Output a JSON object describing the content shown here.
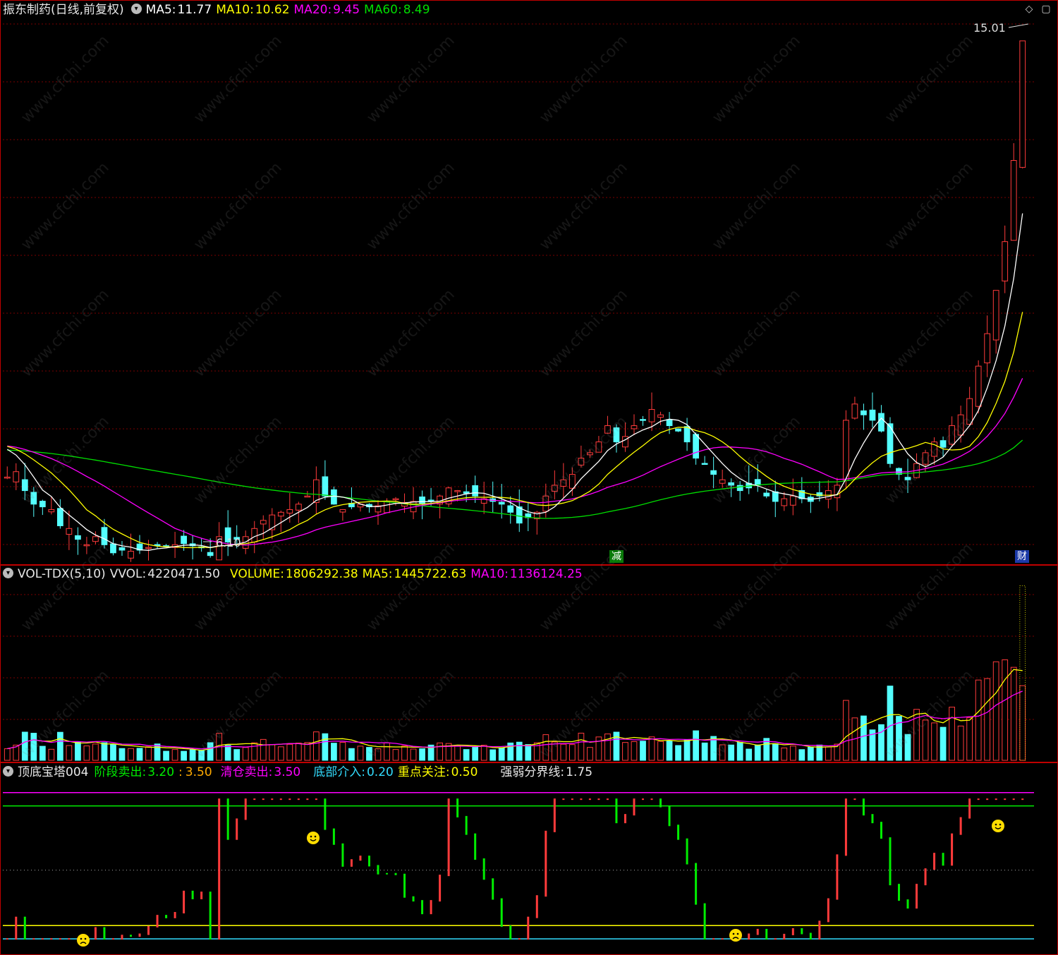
{
  "colors": {
    "up": "#ff3b3b",
    "down": "#54ffff",
    "ma5": "#ffffff",
    "ma10": "#ffff00",
    "ma20": "#ff00ff",
    "ma60": "#00dd00",
    "grid": "#7a0000",
    "divider": "#c00000"
  },
  "main": {
    "title": "振东制药(日线,前复权)",
    "ma5_label": "MA5:",
    "ma5": "11.77",
    "ma10_label": "MA10:",
    "ma10": "10.62",
    "ma20_label": "MA20:",
    "ma20": "9.45",
    "ma60_label": "MA60:",
    "ma60": "8.49",
    "high_label": "15.01",
    "low_label": "6.10",
    "event_reduce": "减",
    "event_finance": "财"
  },
  "volume": {
    "title": "VOL-TDX(5,10)",
    "vvol_label": "VVOL:",
    "vvol": "4220471.50",
    "volume_label": "VOLUME:",
    "volume": "1806292.38",
    "ma5_label": "MA5:",
    "ma5": "1445722.63",
    "ma10_label": "MA10:",
    "ma10": "1136124.25"
  },
  "indicator": {
    "title": "顶底宝塔004",
    "stage_sell_label": "阶段卖出:",
    "stage_sell": "3.20",
    "stage_sell2_sep": ":",
    "stage_sell2": "3.50",
    "clear_sell_label": "清仓卖出:",
    "clear_sell": "3.50",
    "bottom_entry_label": "底部介入:",
    "bottom_entry": "0.20",
    "focus_label": "重点关注:",
    "focus": "0.50",
    "divide_label": "强弱分界线:",
    "divide": "1.75"
  },
  "watermark": "www.cfchi.com",
  "chart_data": {
    "type": "candlestick",
    "price_ylim": [
      5.6,
      15.4
    ],
    "close": [
      6.95,
      7.05,
      6.7,
      6.45,
      6.4,
      6.35,
      6.05,
      6.0,
      5.8,
      5.7,
      5.85,
      5.7,
      5.55,
      5.6,
      5.58,
      5.6,
      5.65,
      5.7,
      5.68,
      5.7,
      5.72,
      5.68,
      5.65,
      5.5,
      5.85,
      5.75,
      5.8,
      5.85,
      6.0,
      6.15,
      6.25,
      6.3,
      6.35,
      6.45,
      6.6,
      6.9,
      6.6,
      6.45,
      6.35,
      6.4,
      6.45,
      6.4,
      6.42,
      6.5,
      6.55,
      6.48,
      6.5,
      6.45,
      6.5,
      6.6,
      6.75,
      6.7,
      6.65,
      6.6,
      6.55,
      6.5,
      6.45,
      6.3,
      6.1,
      6.2,
      6.3,
      6.6,
      6.8,
      6.9,
      7.0,
      7.3,
      7.4,
      7.6,
      7.9,
      7.6,
      7.7,
      7.9,
      8.0,
      8.2,
      8.1,
      7.9,
      7.8,
      7.6,
      7.3,
      7.2,
      7.0,
      6.9,
      6.8,
      6.7,
      6.75,
      6.8,
      6.6,
      6.5,
      6.55,
      6.6,
      6.55,
      6.5,
      6.6,
      6.7,
      6.8,
      8.0,
      8.3,
      8.1,
      8.0,
      7.8,
      7.2,
      7.0,
      6.9,
      7.2,
      7.4,
      7.6,
      7.5,
      7.9,
      8.1,
      8.4,
      9.0,
      9.6,
      10.4,
      11.3,
      12.8,
      15.01
    ],
    "ma_last": {
      "ma5": 11.77,
      "ma10": 10.62,
      "ma20": 9.45,
      "ma60": 8.49
    },
    "volume_last": 1806292.38,
    "indicator_levels": {
      "stage_sell": 3.2,
      "clear_sell": 3.5,
      "bottom_entry": 0.2,
      "focus": 0.5,
      "divide": 1.75
    }
  }
}
